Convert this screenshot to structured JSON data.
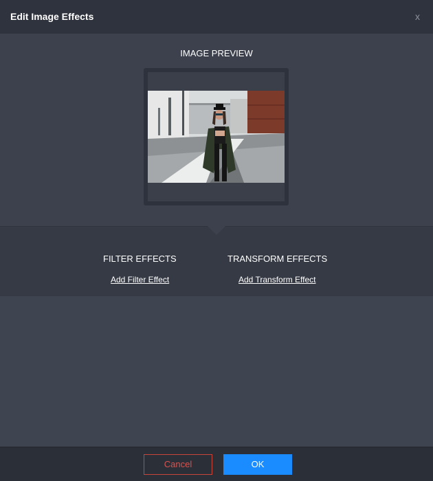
{
  "dialog": {
    "title": "Edit Image Effects",
    "close_label": "x"
  },
  "preview": {
    "heading": "IMAGE PREVIEW"
  },
  "effects": {
    "filter_heading": "FILTER EFFECTS",
    "filter_link": "Add Filter Effect",
    "transform_heading": "TRANSFORM EFFECTS",
    "transform_link": "Add Transform Effect"
  },
  "footer": {
    "cancel_label": "Cancel",
    "ok_label": "OK"
  },
  "colors": {
    "ok_button": "#1a8cff",
    "cancel_border": "#c8453b",
    "titlebar": "#2f333d",
    "background": "#3f4451"
  }
}
